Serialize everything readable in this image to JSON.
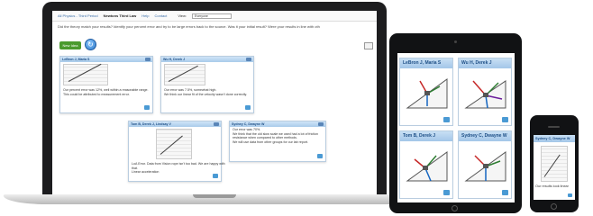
{
  "laptop": {
    "nav": {
      "links": [
        "All Physics - Third Period",
        "Newtons Third Law",
        "Help",
        "Contact"
      ],
      "view_label": "View:",
      "view_value": "Everyone"
    },
    "instructions": "Did the theory match your results? Identify your percent error and try to be large errors back to the source. Was it your initial result? Were your results in line with oth",
    "new_idea_label": "New Idea",
    "cards": [
      {
        "title": "LeBron J, Maria S",
        "lines": [
          "Our percent error was 12%, well within a reasonable range.",
          "This could be attributed to measurement error."
        ]
      },
      {
        "title": "Wu H, Derek J",
        "lines": [
          "Our error was 7.5%, somewhat high.",
          "We think our linear fit of the velocity wasn't done correctly."
        ]
      },
      {
        "title": "Tom B, Derek J, Lindsay V",
        "lines": [
          "LoA Error. Data from Vision rope isn't too bad.  We are happy with",
          "that.",
          "Linear acceleration"
        ]
      },
      {
        "title": "Sydney C, Dwayne W",
        "lines": [
          "Our error was 70%.",
          "We think that the old slow scale we used had a lot of friction",
          "resistance when compared to other methods.",
          "We will use data from other groups for our lab report."
        ]
      }
    ]
  },
  "tablet": {
    "cards": [
      {
        "title": "LeBron J, Maria S"
      },
      {
        "title": "Wu H, Derek J"
      },
      {
        "title": "Tom B, Derek J"
      },
      {
        "title": "Sydney C, Dwayne W"
      }
    ]
  },
  "phone": {
    "card_title": "Sydney C, Dwayne W",
    "text": "Our results look linear"
  },
  "colors": {
    "card_header": "#a9cbea",
    "card_title_text": "#1e4f86",
    "new_idea_button": "#4a9a2e",
    "link": "#3b6ea8",
    "device_body": "#111214"
  }
}
